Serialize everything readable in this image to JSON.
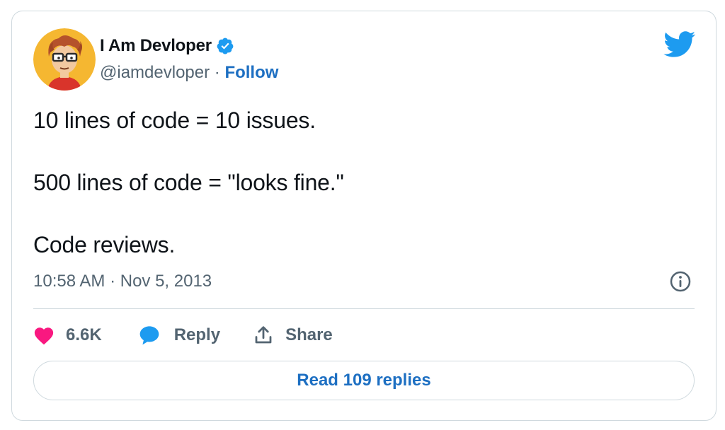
{
  "author": {
    "display_name": "I Am Devloper",
    "handle": "@iamdevloper",
    "separator": " · ",
    "follow_label": "Follow",
    "verified": true
  },
  "tweet": {
    "lines": [
      "10 lines of code = 10 issues.",
      "500 lines of code = \"looks fine.\"",
      "Code reviews."
    ],
    "time": "10:58 AM",
    "date_separator": " · ",
    "date": "Nov 5, 2013"
  },
  "actions": {
    "like_count": "6.6K",
    "reply_label": "Reply",
    "share_label": "Share"
  },
  "read_replies_label": "Read 109 replies",
  "colors": {
    "accent": "#1d6fc2",
    "twitter_blue": "#1d9bf0",
    "heart": "#f91880",
    "muted": "#536471",
    "border": "#cfd9de"
  },
  "icons": {
    "verified": "verified-badge-icon",
    "brand": "twitter-bird-icon",
    "info": "info-icon",
    "like": "heart-icon",
    "reply": "speech-bubble-icon",
    "share": "share-upload-icon"
  }
}
